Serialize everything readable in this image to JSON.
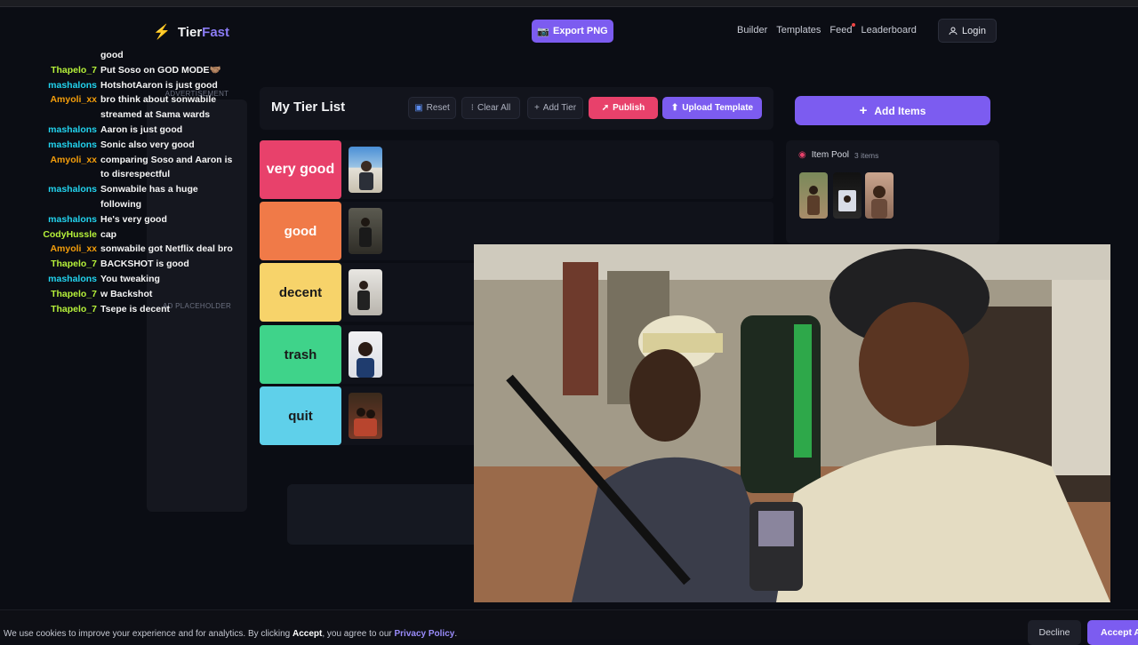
{
  "nav": {
    "logo_a": "Tier",
    "logo_b": "Fast",
    "export_label": "Export PNG",
    "links": [
      "Builder",
      "Templates",
      "Feed",
      "Leaderboard"
    ],
    "login_label": "Login"
  },
  "ads": {
    "advertisement": "ADVERTISEMENT",
    "placeholder": "AD PLACEHOLDER"
  },
  "chat": [
    {
      "user": "",
      "text": "good",
      "color": "#f5f5f5"
    },
    {
      "user": "Thapelo_7",
      "text": "Put Soso on GOD MODE🤝🏽",
      "color": "#b7f23a"
    },
    {
      "user": "mashalons",
      "text": "HotshotAaron is just good",
      "color": "#22d3ee"
    },
    {
      "user": "Amyoli_xx",
      "text": "bro think about sonwabile streamed at Sama wards",
      "color": "#f59e0b"
    },
    {
      "user": "mashalons",
      "text": "Aaron is just good",
      "color": "#22d3ee"
    },
    {
      "user": "mashalons",
      "text": "Sonic also very good",
      "color": "#22d3ee"
    },
    {
      "user": "Amyoli_xx",
      "text": "comparing Soso and Aaron is to disrespectful",
      "color": "#f59e0b"
    },
    {
      "user": "mashalons",
      "text": "Sonwabile has a huge following",
      "color": "#22d3ee"
    },
    {
      "user": "mashalons",
      "text": "He's very good",
      "color": "#22d3ee"
    },
    {
      "user": "CodyHussle",
      "text": "cap",
      "color": "#b7f23a"
    },
    {
      "user": "Amyoli_xx",
      "text": "sonwabile got Netflix deal bro",
      "color": "#f59e0b"
    },
    {
      "user": "Thapelo_7",
      "text": "BACKSHOT is good",
      "color": "#b7f23a"
    },
    {
      "user": "mashalons",
      "text": "You tweaking",
      "color": "#22d3ee"
    },
    {
      "user": "Thapelo_7",
      "text": "w Backshot",
      "color": "#b7f23a"
    },
    {
      "user": "Thapelo_7",
      "text": "Tsepe is decent",
      "color": "#b7f23a"
    }
  ],
  "tierlist": {
    "title": "My Tier List",
    "reset": "Reset",
    "clear_all": "Clear All",
    "add_tier": "Add Tier",
    "publish": "Publish",
    "upload": "Upload Template",
    "tiers": [
      {
        "label": "very good",
        "color": "#e8416b"
      },
      {
        "label": "good",
        "color": "#f07a48"
      },
      {
        "label": "decent",
        "color": "#f7d36a"
      },
      {
        "label": "trash",
        "color": "#3fd38a"
      },
      {
        "label": "quit",
        "color": "#5fd0ea"
      }
    ]
  },
  "pool": {
    "add_items": "Add Items",
    "title": "Item Pool",
    "count": "3 items"
  },
  "cookie": {
    "prefix": "We use cookies to improve your experience and for analytics. By clicking ",
    "accept_word": "Accept",
    "middle": ", you agree to our ",
    "policy": "Privacy Policy",
    "suffix": ".",
    "decline": "Decline",
    "accept": "Accept All"
  }
}
